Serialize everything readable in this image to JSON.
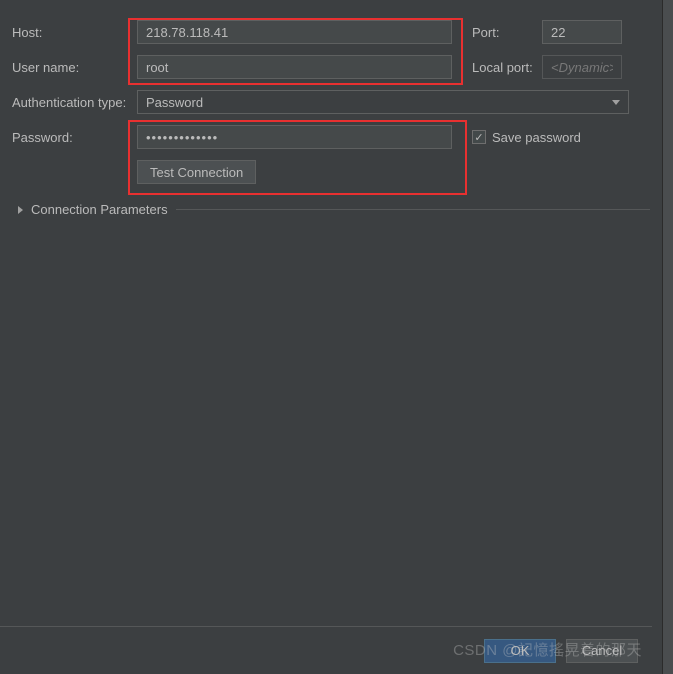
{
  "form": {
    "host_label": "Host:",
    "host_value": "218.78.118.41",
    "port_label": "Port:",
    "port_value": "22",
    "username_label": "User name:",
    "username_value": "root",
    "localport_label": "Local port:",
    "localport_placeholder": "<Dynamic>",
    "authtype_label": "Authentication type:",
    "authtype_value": "Password",
    "password_label": "Password:",
    "password_value": "•••••••••••••",
    "save_password_label": "Save password",
    "save_password_checked": true,
    "test_connection_label": "Test Connection",
    "connection_params_label": "Connection Parameters"
  },
  "footer": {
    "ok_label": "OK",
    "cancel_label": "Cancel"
  },
  "watermark": "CSDN @記憶搖晃着的那天"
}
